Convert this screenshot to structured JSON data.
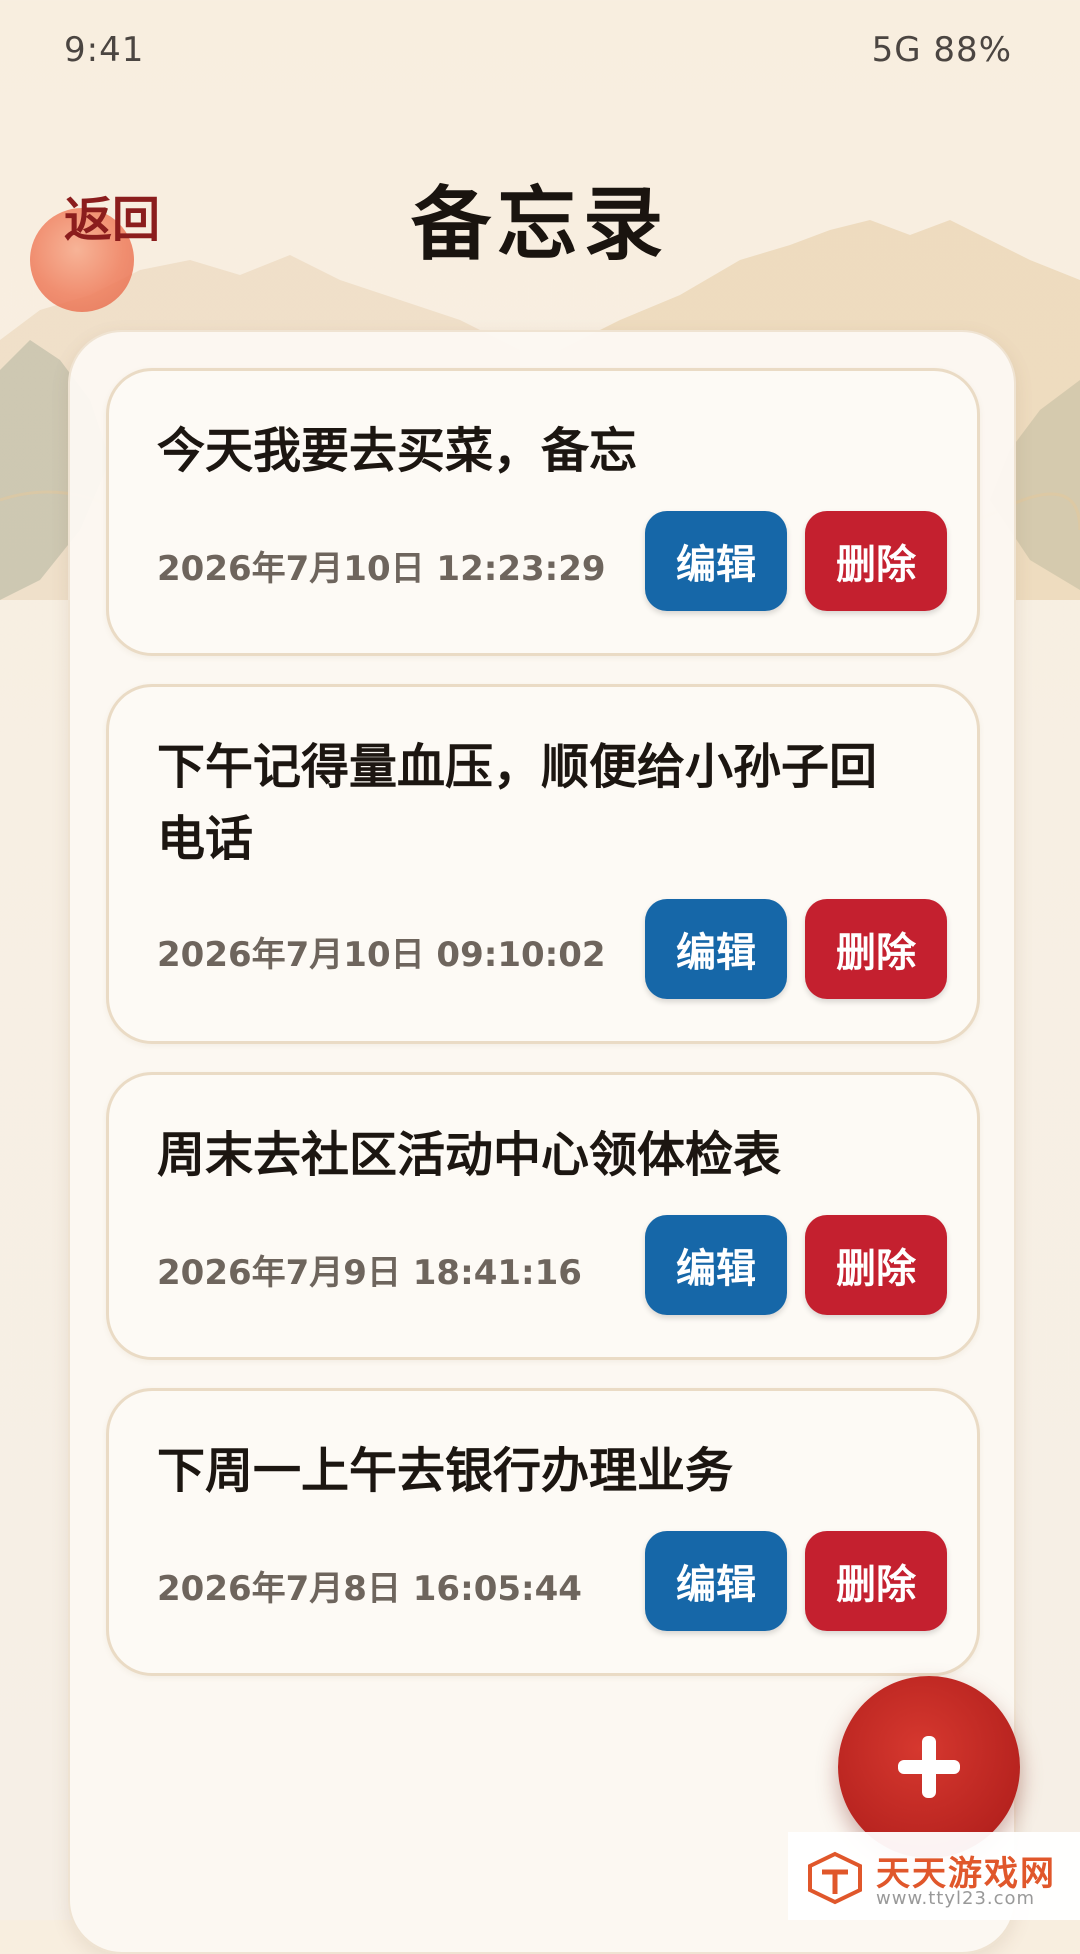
{
  "status_bar": {
    "time": "9:41",
    "network_battery": "5G 88%"
  },
  "header": {
    "back_label": "返回",
    "title": "备忘录"
  },
  "memos": [
    {
      "text": "今天我要去买菜，备忘",
      "timestamp": "2026年7月10日 12:23:29",
      "edit_label": "编辑",
      "delete_label": "删除"
    },
    {
      "text": "下午记得量血压，顺便给小孙子回电话",
      "timestamp": "2026年7月10日 09:10:02",
      "edit_label": "编辑",
      "delete_label": "删除"
    },
    {
      "text": "周末去社区活动中心领体检表",
      "timestamp": "2026年7月9日 18:41:16",
      "edit_label": "编辑",
      "delete_label": "删除"
    },
    {
      "text": "下周一上午去银行办理业务",
      "timestamp": "2026年7月8日 16:05:44",
      "edit_label": "编辑",
      "delete_label": "删除"
    }
  ],
  "fab": {
    "icon": "plus-icon"
  },
  "watermark": {
    "title": "天天游戏网",
    "url": "www.ttyl23.com"
  },
  "colors": {
    "edit_button": "#1667a8",
    "delete_button": "#c4202f",
    "back_text": "#8b1d1d",
    "fab": "#b7231f"
  }
}
